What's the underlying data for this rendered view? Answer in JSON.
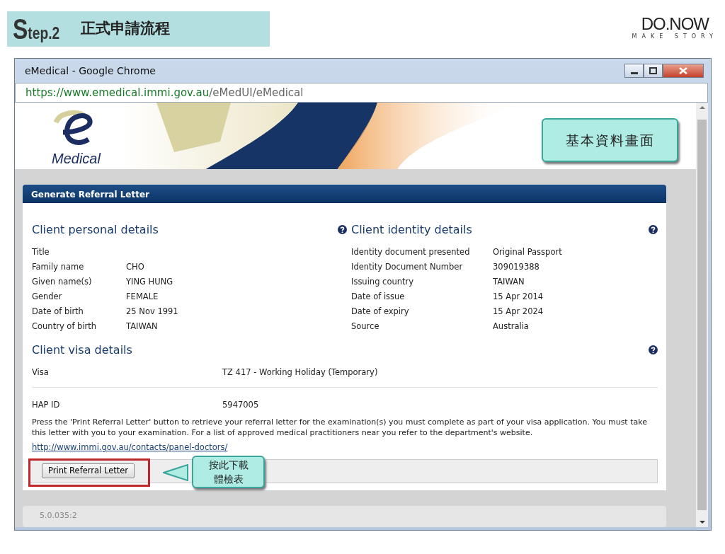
{
  "slide": {
    "step": "Step.2",
    "title": "正式申請流程",
    "logo": "DO.NOW",
    "tagline": "MAKE STORY"
  },
  "window": {
    "title": "eMedical - Google Chrome",
    "url_host": "https://www.emedical.immi.gov.au",
    "url_path": "/eMedUI/eMedical"
  },
  "site": {
    "logo_text": "Medical"
  },
  "callouts": [
    {
      "lines": [
        "基本資料畫面"
      ]
    },
    {
      "lines": [
        "按此下載",
        "體檢表"
      ]
    }
  ],
  "panel": {
    "title": "Generate Referral Letter",
    "personal": {
      "heading": "Client personal details",
      "rows": [
        {
          "label": "Title",
          "value": ""
        },
        {
          "label": "Family name",
          "value": "CHO"
        },
        {
          "label": "Given name(s)",
          "value": "YING HUNG"
        },
        {
          "label": "Gender",
          "value": "FEMALE"
        },
        {
          "label": "Date of birth",
          "value": "25 Nov 1991"
        },
        {
          "label": "Country of birth",
          "value": "TAIWAN"
        }
      ]
    },
    "identity": {
      "heading": "Client identity details",
      "rows": [
        {
          "label": "Identity document presented",
          "value": "Original Passport"
        },
        {
          "label": "Identity Document Number",
          "value": "309019388"
        },
        {
          "label": "Issuing country",
          "value": "TAIWAN"
        },
        {
          "label": "Date of issue",
          "value": "15 Apr 2014"
        },
        {
          "label": "Date of expiry",
          "value": "15 Apr 2024"
        },
        {
          "label": "Source",
          "value": "Australia"
        }
      ]
    },
    "visa": {
      "heading": "Client visa details",
      "rows": [
        {
          "label": "Visa",
          "value": "TZ 417 - Working Holiday (Temporary)"
        },
        {
          "label": "HAP ID",
          "value": "5947005"
        }
      ]
    },
    "note": "Press the 'Print Referral Letter' button to retrieve your referral letter for the examination(s) you must complete as part of your visa application. You must take this letter with you to your examination. For a list of approved medical practitioners near you refer to the department's website.",
    "link": "http://www.immi.gov.au/contacts/panel-doctors/",
    "button": "Print Referral Letter"
  },
  "version": "5.0.035:2"
}
